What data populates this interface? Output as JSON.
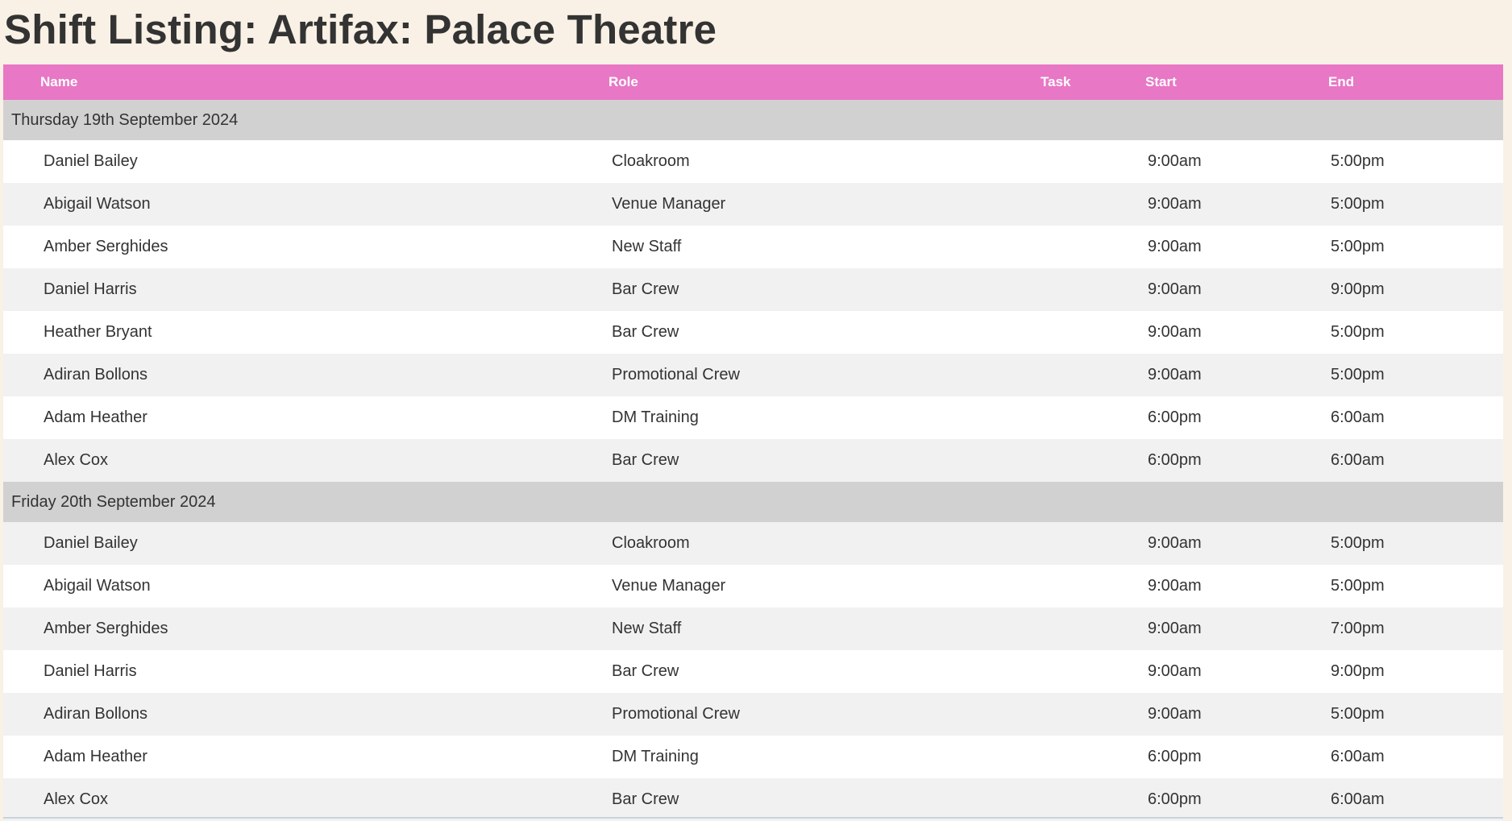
{
  "page": {
    "title": "Shift Listing: Artifax: Palace Theatre"
  },
  "colors": {
    "header_bg": "#e877c5",
    "group_bg": "#d1d1d1",
    "row_alt_bg": "#f1f1f1",
    "page_bg": "#f9f1e5"
  },
  "table": {
    "columns": {
      "name": "Name",
      "role": "Role",
      "task": "Task",
      "start": "Start",
      "end": "End"
    },
    "groups": [
      {
        "date": "Thursday 19th September 2024",
        "shifts": [
          {
            "name": "Daniel Bailey",
            "role": "Cloakroom",
            "task": "",
            "start": "9:00am",
            "end": "5:00pm"
          },
          {
            "name": "Abigail Watson",
            "role": "Venue Manager",
            "task": "",
            "start": "9:00am",
            "end": "5:00pm"
          },
          {
            "name": "Amber Serghides",
            "role": "New Staff",
            "task": "",
            "start": "9:00am",
            "end": "5:00pm"
          },
          {
            "name": "Daniel Harris",
            "role": "Bar Crew",
            "task": "",
            "start": "9:00am",
            "end": "9:00pm"
          },
          {
            "name": "Heather Bryant",
            "role": "Bar Crew",
            "task": "",
            "start": "9:00am",
            "end": "5:00pm"
          },
          {
            "name": "Adiran Bollons",
            "role": "Promotional Crew",
            "task": "",
            "start": "9:00am",
            "end": "5:00pm"
          },
          {
            "name": "Adam Heather",
            "role": "DM Training",
            "task": "",
            "start": "6:00pm",
            "end": "6:00am"
          },
          {
            "name": "Alex Cox",
            "role": "Bar Crew",
            "task": "",
            "start": "6:00pm",
            "end": "6:00am"
          }
        ]
      },
      {
        "date": "Friday 20th September 2024",
        "shifts": [
          {
            "name": "Daniel Bailey",
            "role": "Cloakroom",
            "task": "",
            "start": "9:00am",
            "end": "5:00pm"
          },
          {
            "name": "Abigail Watson",
            "role": "Venue Manager",
            "task": "",
            "start": "9:00am",
            "end": "5:00pm"
          },
          {
            "name": "Amber Serghides",
            "role": "New Staff",
            "task": "",
            "start": "9:00am",
            "end": "7:00pm"
          },
          {
            "name": "Daniel Harris",
            "role": "Bar Crew",
            "task": "",
            "start": "9:00am",
            "end": "9:00pm"
          },
          {
            "name": "Adiran Bollons",
            "role": "Promotional Crew",
            "task": "",
            "start": "9:00am",
            "end": "5:00pm"
          },
          {
            "name": "Adam Heather",
            "role": "DM Training",
            "task": "",
            "start": "6:00pm",
            "end": "6:00am"
          },
          {
            "name": "Alex Cox",
            "role": "Bar Crew",
            "task": "",
            "start": "6:00pm",
            "end": "6:00am"
          }
        ]
      }
    ]
  }
}
